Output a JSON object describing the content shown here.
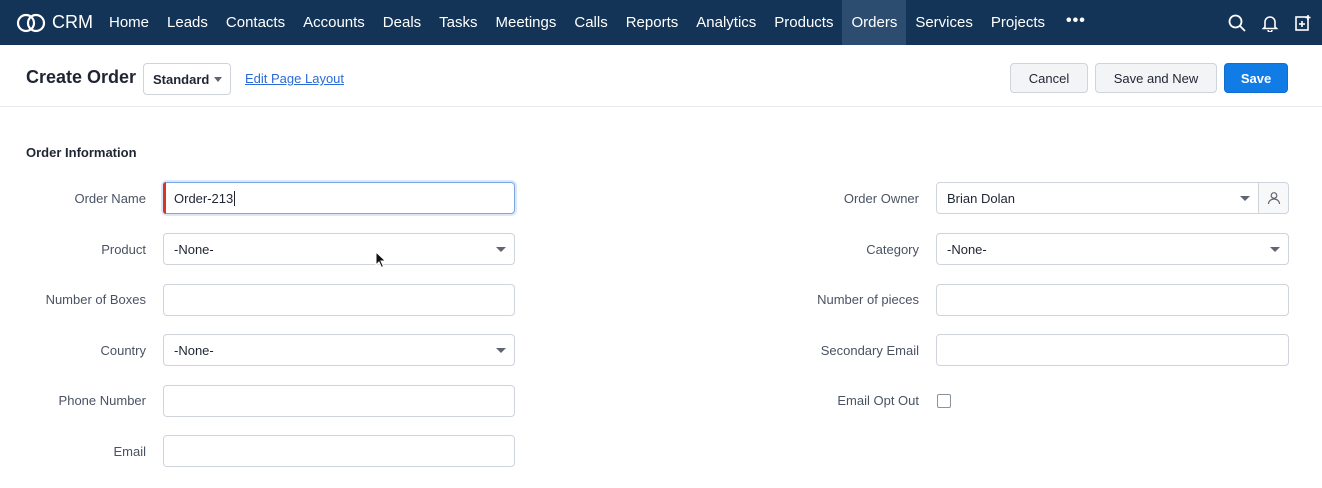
{
  "app": {
    "name": "CRM"
  },
  "nav": {
    "items": [
      "Home",
      "Leads",
      "Contacts",
      "Accounts",
      "Deals",
      "Tasks",
      "Meetings",
      "Calls",
      "Reports",
      "Analytics",
      "Products",
      "Orders",
      "Services",
      "Projects"
    ],
    "active": "Orders",
    "more": "•••",
    "icons": [
      "search-icon",
      "bell-icon",
      "add-note-icon"
    ]
  },
  "header": {
    "title": "Create Order",
    "layout": "Standard",
    "edit_layout_link": "Edit Page Layout",
    "cancel": "Cancel",
    "save_and_new": "Save and New",
    "save": "Save"
  },
  "section": {
    "title": "Order Information"
  },
  "fields_left": {
    "order_name": {
      "label": "Order Name",
      "value": "Order-213"
    },
    "product": {
      "label": "Product",
      "value": "-None-"
    },
    "number_of_boxes": {
      "label": "Number of Boxes",
      "value": ""
    },
    "country": {
      "label": "Country",
      "value": "-None-"
    },
    "phone_number": {
      "label": "Phone Number",
      "value": ""
    },
    "email": {
      "label": "Email",
      "value": ""
    }
  },
  "fields_right": {
    "order_owner": {
      "label": "Order Owner",
      "value": "Brian Dolan"
    },
    "category": {
      "label": "Category",
      "value": "-None-"
    },
    "number_of_pieces": {
      "label": "Number of pieces",
      "value": ""
    },
    "secondary_email": {
      "label": "Secondary Email",
      "value": ""
    },
    "email_opt_out": {
      "label": "Email Opt Out",
      "checked": false
    }
  },
  "colors": {
    "nav_bg": "#133456",
    "nav_active": "#2c4d70",
    "primary": "#127ce6",
    "mandatory": "#d9342b",
    "link": "#2b6bd6"
  }
}
